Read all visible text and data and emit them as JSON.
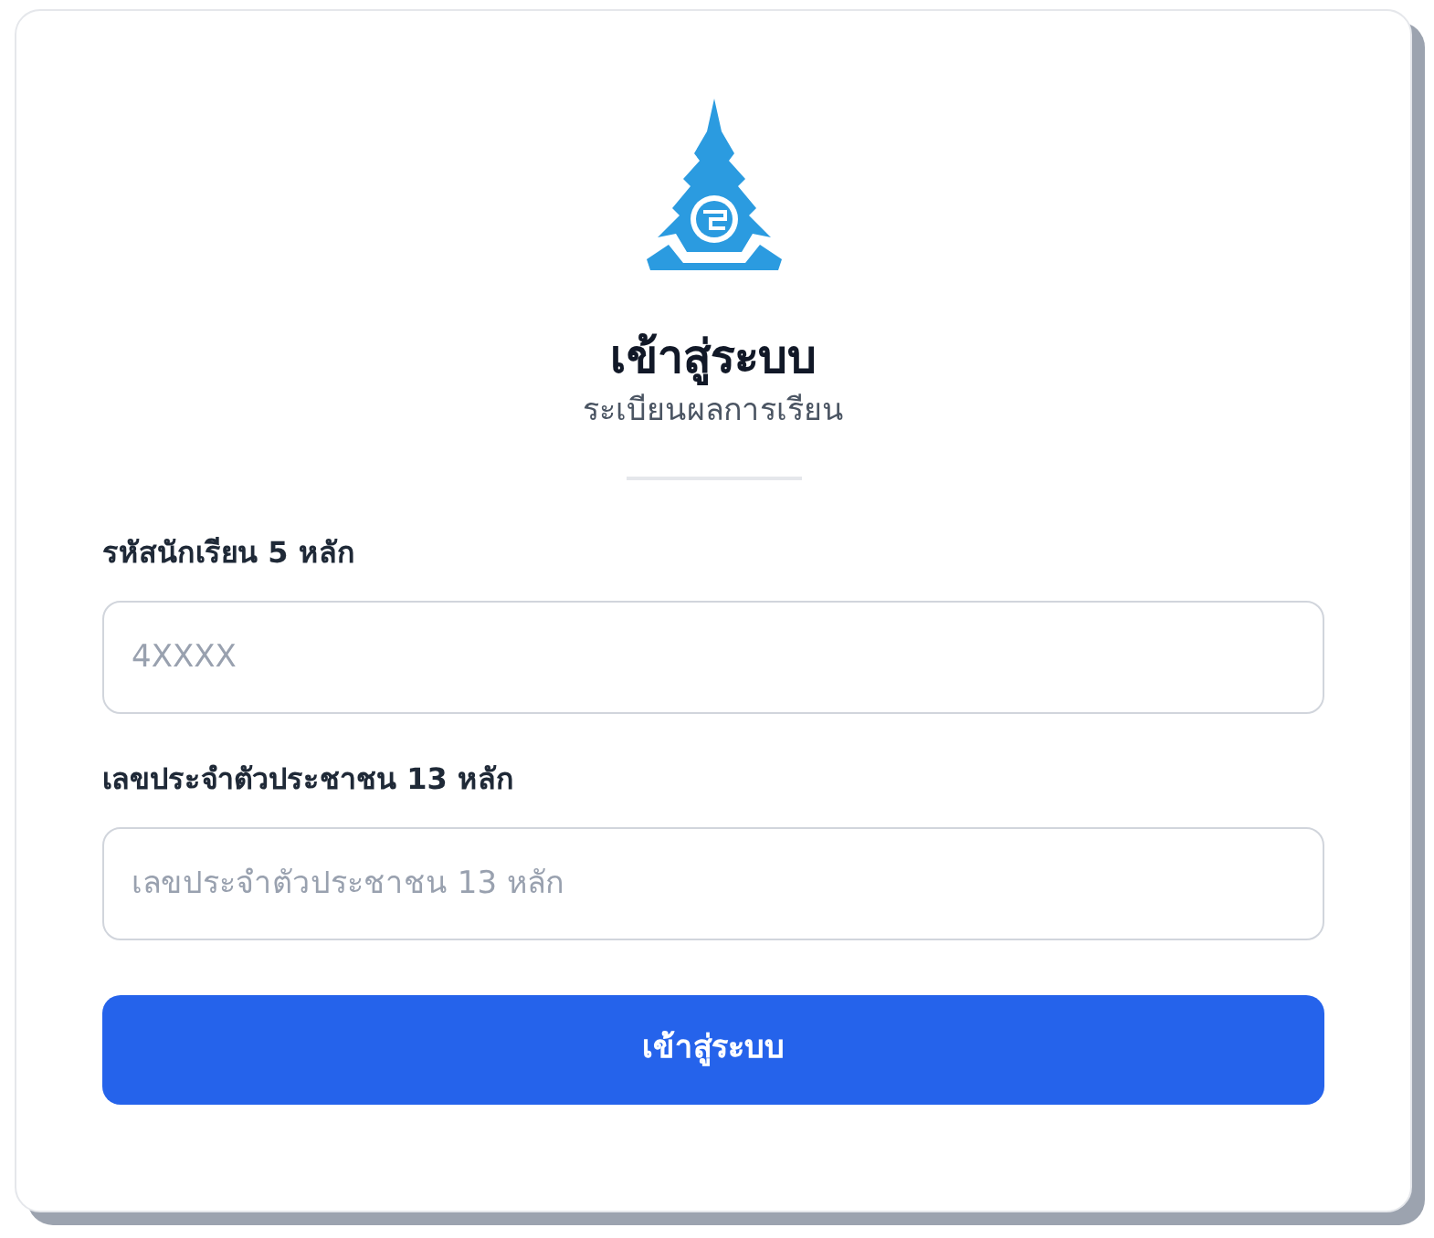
{
  "title": "เข้าสู่ระบบ",
  "subtitle": "ระเบียนผลการเรียน",
  "fields": [
    {
      "label": "รหัสนักเรียน 5 หลัก",
      "placeholder": "4XXXX"
    },
    {
      "label": "เลขประจำตัวประชาชน 13 หลัก",
      "placeholder": "เลขประจำตัวประชาชน 13 หลัก"
    }
  ],
  "submit_button": "เข้าสู่ระบบ"
}
